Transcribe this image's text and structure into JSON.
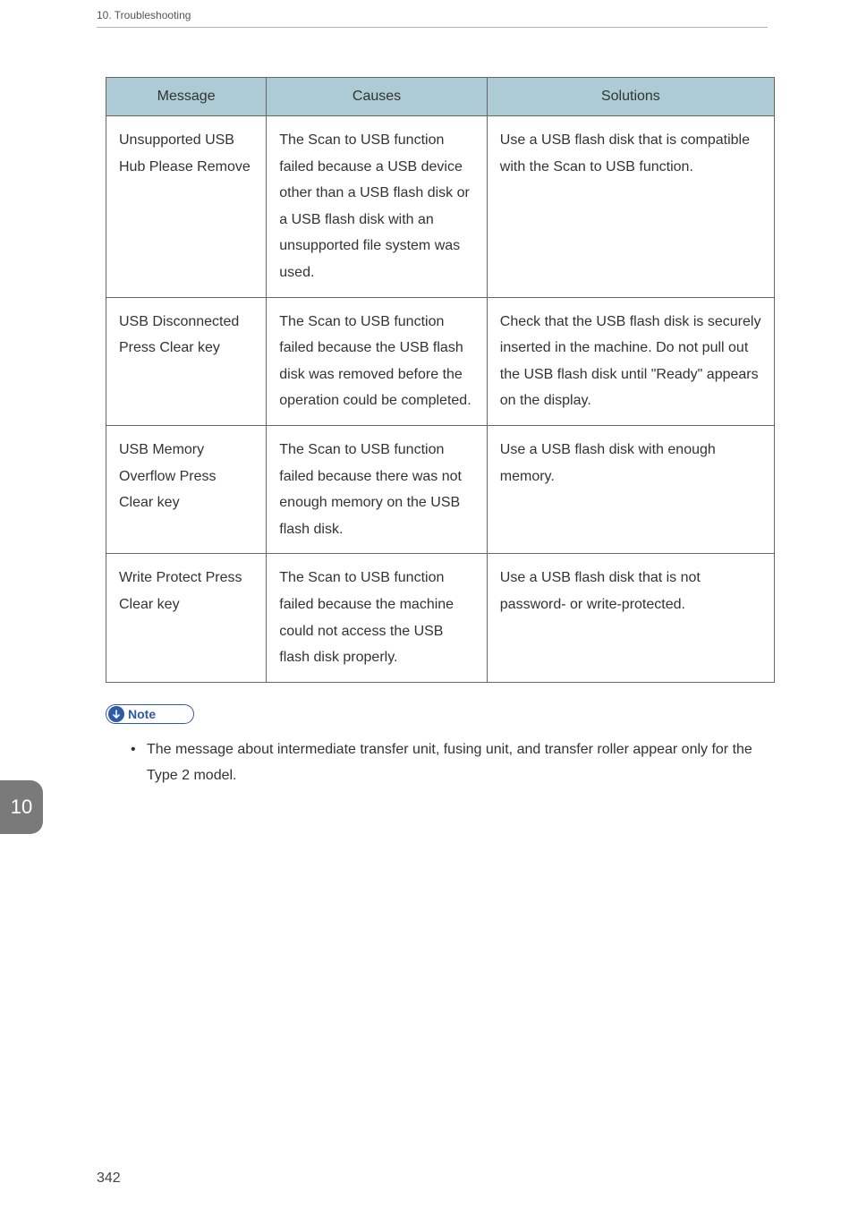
{
  "header": {
    "chapter_title": "10. Troubleshooting"
  },
  "table": {
    "headers": {
      "message": "Message",
      "causes": "Causes",
      "solutions": "Solutions"
    },
    "rows": [
      {
        "message": "Unsupported USB Hub Please Remove",
        "causes": "The Scan to USB function failed because a USB device other than a USB flash disk or a USB flash disk with an unsupported file system was used.",
        "solutions": "Use a USB flash disk that is compatible with the Scan to USB function."
      },
      {
        "message": "USB Disconnected Press Clear key",
        "causes": "The Scan to USB function failed because the USB flash disk was removed before the operation could be completed.",
        "solutions": "Check that the USB flash disk is securely inserted in the machine. Do not pull out the USB flash disk until \"Ready\" appears on the display."
      },
      {
        "message": "USB Memory Overflow Press Clear key",
        "causes": "The Scan to USB function failed because there was not enough memory on the USB flash disk.",
        "solutions": "Use a USB flash disk with enough memory."
      },
      {
        "message": "Write Protect Press Clear key",
        "causes": "The Scan to USB function failed because the machine could not access the USB flash disk properly.",
        "solutions": "Use a USB flash disk that is not password- or write-protected."
      }
    ]
  },
  "note": {
    "label": "Note",
    "items": [
      "The message about intermediate transfer unit, fusing unit, and transfer roller appear only for the Type 2 model."
    ]
  },
  "chapter_tab": "10",
  "page_number": "342"
}
